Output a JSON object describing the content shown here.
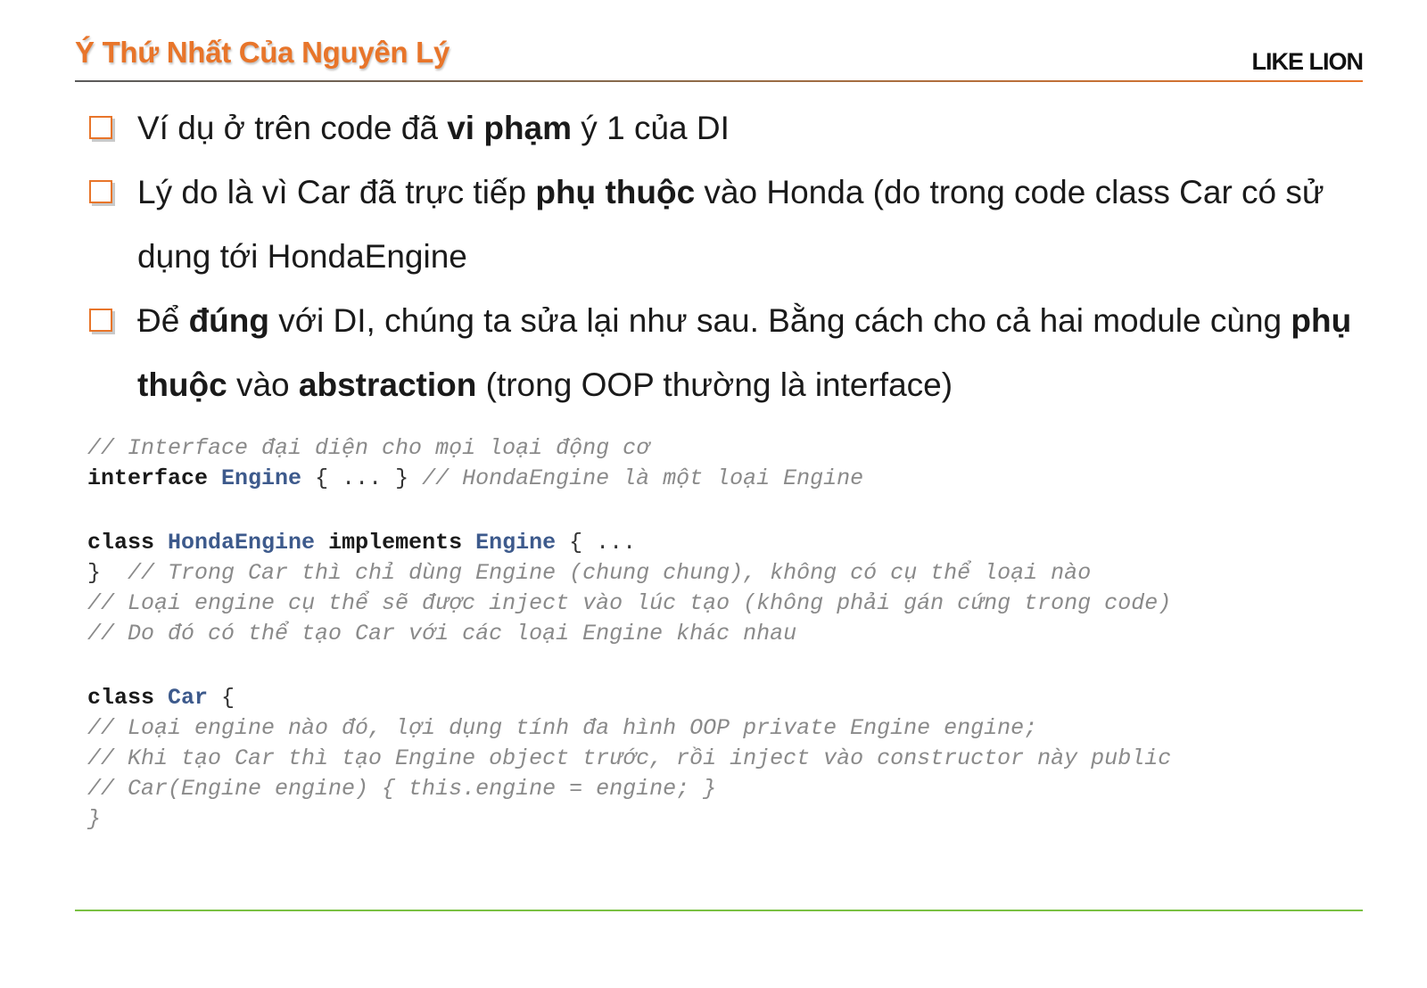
{
  "header": {
    "title": "Ý Thứ Nhất Của Nguyên Lý",
    "brand": "LIKE LION"
  },
  "bullets": [
    {
      "parts": [
        {
          "text": "Ví dụ ở trên code đã ",
          "bold": false
        },
        {
          "text": "vi phạm",
          "bold": true
        },
        {
          "text": " ý 1 của DI",
          "bold": false
        }
      ]
    },
    {
      "parts": [
        {
          "text": "Lý do là vì Car đã trực tiếp ",
          "bold": false
        },
        {
          "text": "phụ thuộc",
          "bold": true
        },
        {
          "text": " vào Honda (do trong code class Car có sử dụng tới HondaEngine",
          "bold": false
        }
      ]
    },
    {
      "parts": [
        {
          "text": "Để ",
          "bold": false
        },
        {
          "text": "đúng",
          "bold": true
        },
        {
          "text": " với DI, chúng ta sửa lại như sau. Bằng cách cho cả hai module cùng ",
          "bold": false
        },
        {
          "text": "phụ thuộc",
          "bold": true
        },
        {
          "text": " vào ",
          "bold": false
        },
        {
          "text": "abstraction",
          "bold": true
        },
        {
          "text": " (trong OOP thường là interface)",
          "bold": false
        }
      ]
    }
  ],
  "code": {
    "lines": [
      {
        "tokens": [
          {
            "t": "// Interface đại diện cho mọi loại động cơ",
            "c": "cm"
          }
        ]
      },
      {
        "tokens": [
          {
            "t": "interface",
            "c": "kw"
          },
          {
            "t": " ",
            "c": "pl"
          },
          {
            "t": "Engine",
            "c": "ty"
          },
          {
            "t": " { ... } ",
            "c": "pl"
          },
          {
            "t": "// HondaEngine là một loại Engine",
            "c": "cm"
          }
        ]
      },
      {
        "gap": true
      },
      {
        "tokens": [
          {
            "t": "class",
            "c": "kw"
          },
          {
            "t": " ",
            "c": "pl"
          },
          {
            "t": "HondaEngine",
            "c": "ty"
          },
          {
            "t": " ",
            "c": "pl"
          },
          {
            "t": "implements",
            "c": "kw"
          },
          {
            "t": " ",
            "c": "pl"
          },
          {
            "t": "Engine",
            "c": "ty"
          },
          {
            "t": " { ...",
            "c": "pl"
          }
        ]
      },
      {
        "tokens": [
          {
            "t": "}  ",
            "c": "pl"
          },
          {
            "t": "// Trong Car thì chỉ dùng Engine (chung chung), không có cụ thể loại nào",
            "c": "cm"
          }
        ]
      },
      {
        "tokens": [
          {
            "t": "// Loại engine cụ thể sẽ được inject vào lúc tạo (không phải gán cứng trong code)",
            "c": "cm"
          }
        ]
      },
      {
        "tokens": [
          {
            "t": "// Do đó có thể tạo Car với các loại Engine khác nhau",
            "c": "cm"
          }
        ]
      },
      {
        "gap": true
      },
      {
        "tokens": [
          {
            "t": "class",
            "c": "kw"
          },
          {
            "t": " ",
            "c": "pl"
          },
          {
            "t": "Car",
            "c": "ty"
          },
          {
            "t": " {",
            "c": "pl"
          }
        ]
      },
      {
        "tokens": [
          {
            "t": "// Loại engine nào đó, lợi dụng tính đa hình OOP private Engine engine;",
            "c": "cm"
          }
        ]
      },
      {
        "tokens": [
          {
            "t": "// Khi tạo Car thì tạo Engine object trước, rồi inject vào constructor này public",
            "c": "cm"
          }
        ]
      },
      {
        "tokens": [
          {
            "t": "// Car(Engine engine) { this.engine = engine; }",
            "c": "cm"
          }
        ]
      },
      {
        "tokens": [
          {
            "t": "}",
            "c": "cm"
          }
        ]
      }
    ]
  }
}
